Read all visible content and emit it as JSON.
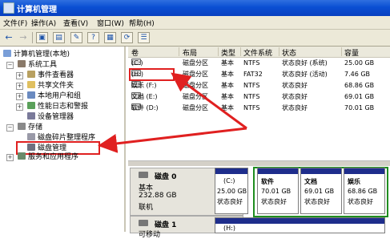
{
  "window": {
    "title": "计算机管理"
  },
  "menu": [
    "文件(F)",
    "操作(A)",
    "查看(V)",
    "窗口(W)",
    "帮助(H)"
  ],
  "toolbar": {
    "icons": [
      "back-arrow",
      "forward-arrow",
      "up-folder",
      "show-hide-tree",
      "properties",
      "help",
      "export-list",
      "refresh",
      "help-topic"
    ]
  },
  "tree": {
    "root": "计算机管理(本地)",
    "system_tools": "系统工具",
    "event_viewer": "事件查看器",
    "shared_folders": "共享文件夹",
    "local_users": "本地用户和组",
    "perf_logs": "性能日志和警报",
    "device_manager": "设备管理器",
    "storage": "存储",
    "defrag": "磁盘碎片整理程序",
    "disk_mgmt": "磁盘管理",
    "services": "服务和应用程序"
  },
  "volume_table": {
    "headers": [
      "卷",
      "布局",
      "类型",
      "文件系统",
      "状态",
      "容量"
    ],
    "rows": [
      {
        "vol": "(C:)",
        "layout": "磁盘分区",
        "type": "基本",
        "fs": "NTFS",
        "status": "状态良好 (系统)",
        "cap": "25.00 GB"
      },
      {
        "vol": "(H:)",
        "layout": "磁盘分区",
        "type": "基本",
        "fs": "FAT32",
        "status": "状态良好 (活动)",
        "cap": "7.46 GB"
      },
      {
        "vol": "娱乐 (F:)",
        "layout": "磁盘分区",
        "type": "基本",
        "fs": "NTFS",
        "status": "状态良好",
        "cap": "68.86 GB"
      },
      {
        "vol": "文档 (E:)",
        "layout": "磁盘分区",
        "type": "基本",
        "fs": "NTFS",
        "status": "状态良好",
        "cap": "69.01 GB"
      },
      {
        "vol": "软件 (D:)",
        "layout": "磁盘分区",
        "type": "基本",
        "fs": "NTFS",
        "status": "状态良好",
        "cap": "70.01 GB"
      }
    ]
  },
  "disk0": {
    "name": "磁盘 0",
    "type": "基本",
    "size": "232.88 GB",
    "status": "联机",
    "partitions": [
      {
        "label": "(C:)",
        "size": "25.00 GB",
        "status": "状态良好"
      },
      {
        "label": "软件",
        "size": "70.01 GB",
        "status": "状态良好"
      },
      {
        "label": "文档",
        "size": "69.01 GB",
        "status": "状态良好"
      },
      {
        "label": "娱乐",
        "size": "68.86 GB",
        "status": "状态良好"
      }
    ]
  },
  "disk1": {
    "name": "磁盘 1",
    "type": "可移动",
    "partition": "(H:)"
  },
  "colors": {
    "title_bar": "#0a4fd3",
    "highlight": "#e02020",
    "extended": "#1f8d1f",
    "partition_bar": "#1e2d8c"
  }
}
